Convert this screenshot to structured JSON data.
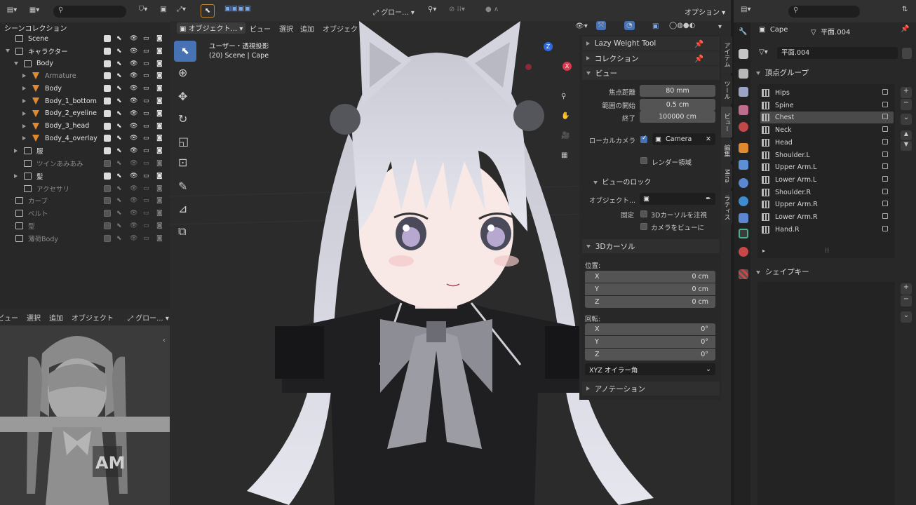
{
  "outliner": {
    "title": "シーンコレクション",
    "rows": [
      {
        "label": "Scene",
        "indent": 0,
        "exp": "",
        "col": "#e6e6e6"
      },
      {
        "label": "キャラクター",
        "indent": 0,
        "exp": "d",
        "col": "#e6e6e6"
      },
      {
        "label": "Body",
        "indent": 1,
        "exp": "d",
        "col": "#e6e6e6"
      },
      {
        "label": "Armature",
        "indent": 2,
        "exp": "r",
        "col": "#9a9a9a"
      },
      {
        "label": "Body",
        "indent": 2,
        "exp": "r",
        "col": "#e6e6e6"
      },
      {
        "label": "Body_1_bottom",
        "indent": 2,
        "exp": "r",
        "col": "#e6e6e6"
      },
      {
        "label": "Body_2_eyeline",
        "indent": 2,
        "exp": "r",
        "col": "#e6e6e6"
      },
      {
        "label": "Body_3_head",
        "indent": 2,
        "exp": "r",
        "col": "#e6e6e6"
      },
      {
        "label": "Body_4_overlay",
        "indent": 2,
        "exp": "r",
        "col": "#e6e6e6"
      },
      {
        "label": "服",
        "indent": 1,
        "exp": "r",
        "col": "#e6e6e6"
      },
      {
        "label": "ツインあみあみ",
        "indent": 1,
        "exp": "",
        "col": "#8a8a8a"
      },
      {
        "label": "髪",
        "indent": 1,
        "exp": "r",
        "col": "#e6e6e6"
      },
      {
        "label": "アクセサリ",
        "indent": 1,
        "exp": "",
        "col": "#8a8a8a"
      },
      {
        "label": "カーブ",
        "indent": 0,
        "exp": "",
        "col": "#8a8a8a"
      },
      {
        "label": "ベルト",
        "indent": 0,
        "exp": "",
        "col": "#8a8a8a"
      },
      {
        "label": "型",
        "indent": 0,
        "exp": "",
        "col": "#8a8a8a"
      },
      {
        "label": "薄荷Body",
        "indent": 0,
        "exp": "",
        "col": "#8a8a8a"
      }
    ]
  },
  "mini_viewport": {
    "menu": [
      "ビュー",
      "選択",
      "追加",
      "オブジェクト"
    ],
    "transform": "グロー..."
  },
  "viewport": {
    "menu": [
      "オブジェクト...",
      "ビュー",
      "選択",
      "追加",
      "オブジェクト"
    ],
    "transform": "グロー...",
    "options": "オプション",
    "info_line1": "ユーザー・透視投影",
    "info_line2": "(20) Scene | Cape"
  },
  "npanel": {
    "lazy": "Lazy Weight Tool",
    "collection": "コレクション",
    "view": "ビュー",
    "focal_label": "焦点距離",
    "focal": "80 mm",
    "clip_start_label": "範囲の開始",
    "clip_start": "0.5 cm",
    "clip_end_label": "終了",
    "clip_end": "100000 cm",
    "local_camera_label": "ローカルカメラ",
    "camera": "Camera",
    "render_region": "レンダー領域",
    "view_lock": "ビューのロック",
    "object_label": "オブジェクト...",
    "lock_label": "固定",
    "lock_cursor": "3Dカーソルを注視",
    "lock_camera": "カメラをビューに",
    "cursor3d": "3Dカーソル",
    "location": "位置:",
    "loc_x": "0 cm",
    "loc_y": "0 cm",
    "loc_z": "0 cm",
    "rotation": "回転:",
    "rot_x": "0°",
    "rot_y": "0°",
    "rot_z": "0°",
    "euler": "XYZ オイラー角",
    "annotation": "アノテーション",
    "tabs": [
      "アイテム",
      "ツール",
      "ビュー",
      "編集",
      "Mira",
      "ラティス"
    ]
  },
  "props": {
    "object": "Cape",
    "mesh": "平面.004",
    "mesh_field": "平面.004",
    "vertex_groups": "頂点グループ",
    "groups": [
      "Hips",
      "Spine",
      "Chest",
      "Neck",
      "Head",
      "Shoulder.L",
      "Upper Arm.L",
      "Lower Arm.L",
      "Shoulder.R",
      "Upper Arm.R",
      "Lower Arm.R",
      "Hand.R"
    ],
    "active": "Chest",
    "shape_keys": "シェイプキー"
  },
  "axes": {
    "x": "X",
    "y": "Y",
    "z": "Z"
  },
  "colors": {
    "accent": "#4772b3",
    "header": "#303030",
    "panel": "#282828"
  }
}
